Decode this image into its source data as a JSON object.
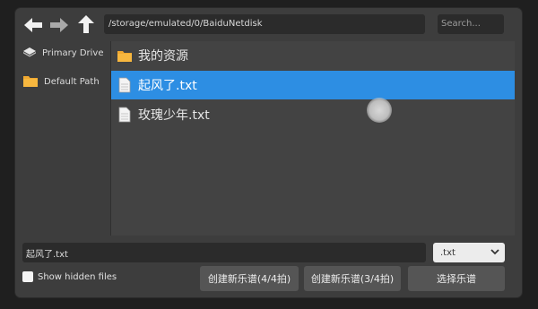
{
  "toolbar": {
    "path": "/storage/emulated/0/BaiduNetdisk",
    "search_placeholder": "Search..."
  },
  "sidebar": {
    "items": [
      {
        "label": "Primary Drive",
        "icon": "drive-icon"
      },
      {
        "label": "Default Path",
        "icon": "folder-icon"
      }
    ]
  },
  "files": [
    {
      "name": "我的资源",
      "type": "folder",
      "selected": false
    },
    {
      "name": "起风了.txt",
      "type": "file",
      "selected": true
    },
    {
      "name": "玫瑰少年.txt",
      "type": "file",
      "selected": false
    }
  ],
  "bottom": {
    "filename": "起风了.txt",
    "extension": ".txt",
    "show_hidden_label": "Show hidden files",
    "btn_create_44": "创建新乐谱(4/4拍)",
    "btn_create_34": "创建新乐谱(3/4拍)",
    "btn_select": "选择乐谱"
  },
  "colors": {
    "selection": "#2d8ee3",
    "folder": "#f0a830",
    "background": "#3d3d3d"
  }
}
